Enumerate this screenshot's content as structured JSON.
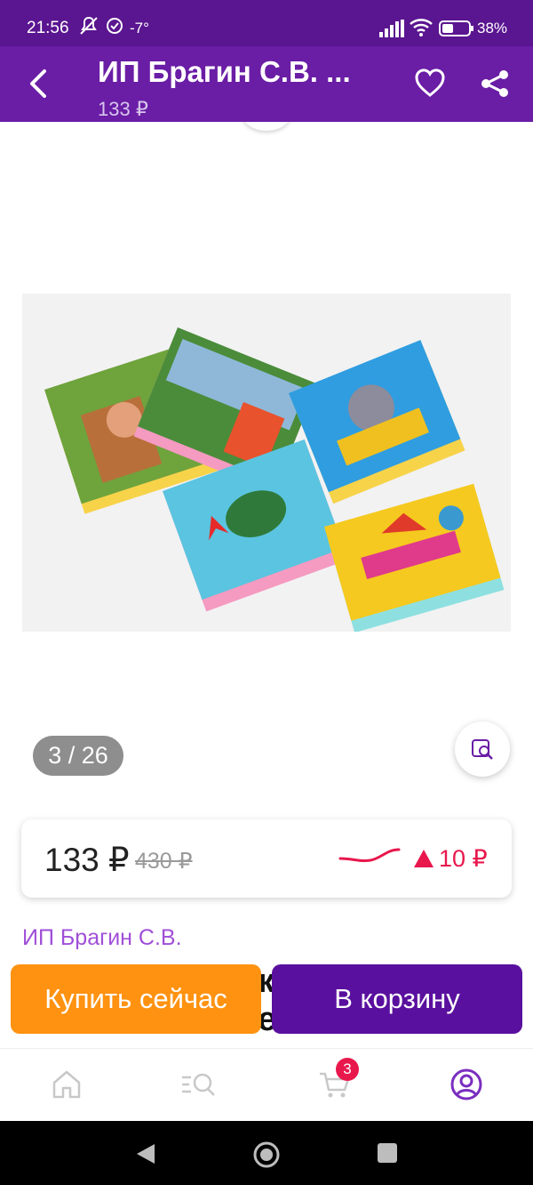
{
  "status_bar": {
    "time": "21:56",
    "temperature": "-7°",
    "battery": "38%"
  },
  "header": {
    "title": "ИП Брагин С.В. ...",
    "price": "133 ₽",
    "icons": [
      "back-arrow-icon",
      "heart-icon",
      "share-icon"
    ]
  },
  "gallery": {
    "counter": "3 / 26"
  },
  "price_card": {
    "current": "133 ₽",
    "old": "430 ₽",
    "change": "10 ₽",
    "change_color": "#e8174c"
  },
  "seller": "ИП Брагин С.В.",
  "product_title_peek": [
    "ки",
    "е"
  ],
  "actions": {
    "buy_now": "Купить сейчас",
    "add_to_cart": "В корзину"
  },
  "bottom_nav": {
    "cart_badge": "3",
    "active": "profile"
  },
  "colors": {
    "header": "#6a1da5",
    "status": "#5a1590",
    "buy": "#ff9211",
    "cart": "#5a109e",
    "accent": "#a04fd8"
  }
}
